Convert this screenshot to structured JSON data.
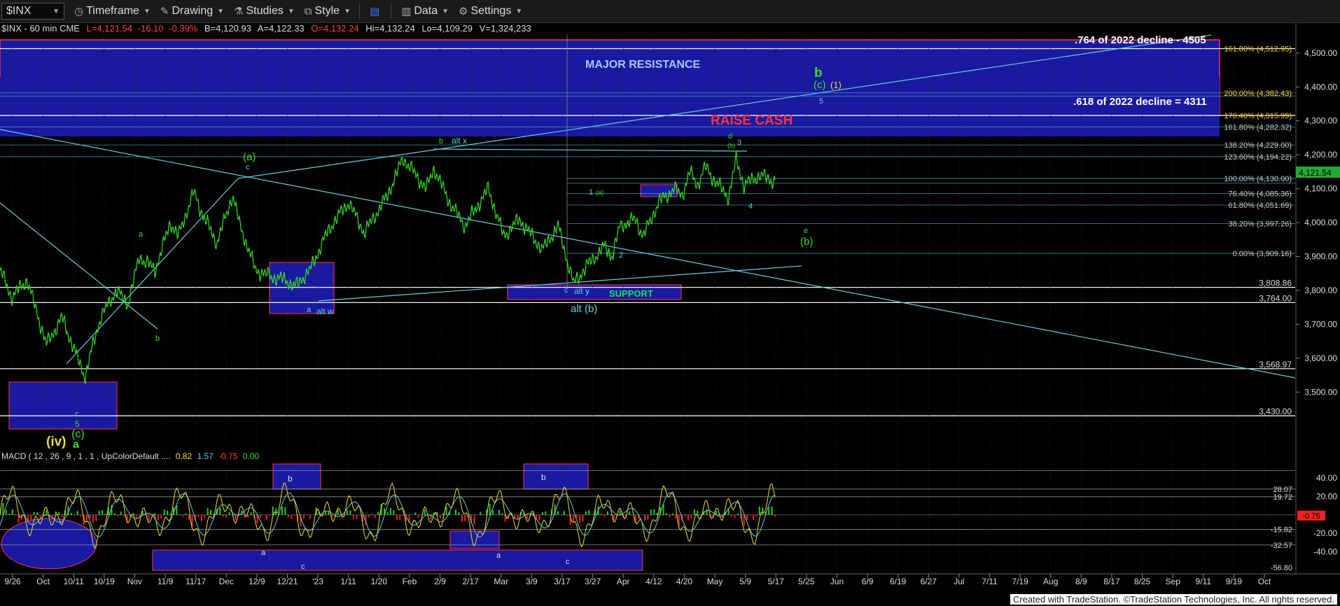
{
  "toolbar": {
    "symbol": "$INX",
    "items": [
      "Timeframe",
      "Drawing",
      "Studies",
      "Style",
      "Data",
      "Settings"
    ]
  },
  "quote_line": {
    "name": "$INX - 60 min  CME",
    "L": "L=4,121.54",
    "chg": "-16.10",
    "pct": "-0.39%",
    "B": "B=4,120.93",
    "A": "A=4,122.33",
    "O": "O=4,132.24",
    "Hi": "Hi=4,132.24",
    "Lo": "Lo=4,109.29",
    "V": "V=1,324,233"
  },
  "macd_label": {
    "name": "MACD ( 12 , 26 , 9 , 1 , 1 , UpColorDefault ....",
    "v1": "0.82",
    "v2": "1.57",
    "v3": "-0.75",
    "v4": "0.00"
  },
  "footer": "Created with TradeStation. ©TradeStation Technologies, Inc. All rights reserved.",
  "colors": {
    "background": "#000000",
    "price": "#33dd22",
    "box_fill": "#1a1aa0",
    "box_edge": "#ff3355",
    "cyan": "#66ccdd",
    "up_hist": "#22cc22",
    "down_hist": "#ee2222",
    "last_price_badge": "#22aa33"
  },
  "chart_data": {
    "type": "line",
    "title": "",
    "price_axis": {
      "ylim": [
        3385,
        4545
      ],
      "ticks": [
        3500,
        3600,
        3700,
        3800,
        3900,
        4000,
        4100,
        4200,
        4300,
        4400,
        4500
      ],
      "tick_labels": [
        "3,500.00",
        "3,600.00",
        "3,700.00",
        "3,800.00",
        "3,900.00",
        "4,000.00",
        "4,100.00",
        "4,200.00",
        "4,300.00",
        "4,400.00",
        "4,500.00"
      ]
    },
    "macd_axis": {
      "ylim": [
        -60,
        56
      ],
      "ticks": [
        40,
        20,
        -20,
        -40
      ],
      "tick_labels": [
        "40.00",
        "20.00",
        "-20.00",
        "-40.00"
      ]
    },
    "x_axis_labels": [
      "9/26",
      "Oct",
      "10/11",
      "10/19",
      "Nov",
      "11/9",
      "11/17",
      "Dec",
      "12/9",
      "12/21",
      "'23",
      "1/11",
      "1/20",
      "Feb",
      "2/9",
      "2/17",
      "Mar",
      "3/9",
      "3/17",
      "3/27",
      "Apr",
      "4/12",
      "4/20",
      "May",
      "5/9",
      "5/17",
      "5/25",
      "Jun",
      "6/9",
      "6/19",
      "6/27",
      "Jul",
      "7/11",
      "7/19",
      "Aug",
      "8/9",
      "8/17",
      "8/25",
      "Sep",
      "9/11",
      "9/19",
      "Oct"
    ],
    "price_path": {
      "t": [
        0,
        0.015,
        0.035,
        0.06,
        0.08,
        0.1,
        0.11,
        0.12,
        0.13,
        0.15,
        0.165,
        0.18,
        0.2,
        0.22,
        0.23,
        0.25,
        0.26,
        0.28,
        0.3,
        0.31,
        0.33,
        0.35,
        0.37,
        0.38,
        0.4,
        0.42,
        0.43,
        0.45,
        0.47,
        0.5,
        0.52,
        0.55,
        0.56,
        0.58,
        0.6,
        0.63,
        0.65,
        0.67,
        0.7,
        0.72,
        0.74,
        0.76,
        0.78,
        0.79,
        0.8,
        0.82,
        0.83,
        0.85,
        0.87,
        0.88,
        0.89,
        0.9,
        0.91,
        0.92,
        0.94,
        0.95,
        0.96,
        0.98,
        1.0
      ],
      "v": [
        3860,
        3780,
        3830,
        3640,
        3720,
        3600,
        3545,
        3640,
        3720,
        3800,
        3760,
        3900,
        3860,
        4000,
        3960,
        4090,
        4030,
        3940,
        4080,
        3990,
        3860,
        3840,
        3830,
        3810,
        3860,
        3960,
        4000,
        4060,
        3970,
        4080,
        4190,
        4100,
        4160,
        4060,
        3990,
        4100,
        3960,
        4010,
        3920,
        3990,
        3820,
        3880,
        3930,
        3900,
        3990,
        4010,
        3960,
        4060,
        4100,
        4080,
        4150,
        4110,
        4165,
        4130,
        4075,
        4185,
        4110,
        4140,
        4121
      ]
    },
    "resistance_levels": [
      "4,512.95",
      "4,382.43",
      "4,373.20",
      "4,315.99",
      "4,282.32",
      "4,229.00",
      "4,194.22",
      "4,130.00",
      "4,115.94",
      "4,085.36",
      "4,051.69",
      "3,997.26",
      "3,909.16",
      "3,808.86",
      "3,764.00",
      "3,568.97",
      "3,430.00"
    ],
    "fib_labels": [
      "161.80% (4,512.95)",
      "200.00% (4,382.43)",
      "176.40% (4,315.99)",
      "161.80% (4,282.32)",
      "138.20% (4,229.00)",
      "123.60% (4,194.22)",
      "100.00% (4,130.00)",
      "76.40% (4,085.36)",
      "61.80% (4,051.69)",
      "38.20% (3,997.26)",
      "0.00% (3,909.16)"
    ],
    "last_price": "4,121.54",
    "macd_right_labels": [
      "28.07",
      "19.72",
      "-0.75",
      "-15.82",
      "-32.57",
      "-56.80"
    ],
    "annotations": {
      "major_resistance": "MAJOR RESISTANCE",
      "raise_cash": "RAISE CASH",
      "support": "SUPPORT",
      "fib_764": ".764 of 2022 decline - 4505",
      "fib_618": ".618 of 2022 decline = 4311",
      "alt_b": "alt (b)",
      "alt_w": "alt w",
      "alt_x": "alt x",
      "alt_y": "alt y",
      "wave_iv": "(iv)",
      "wave_c_bottom": "(c)",
      "wave_a_bottom": "a",
      "wave_5_bottom": "5",
      "wave_c_small": "c",
      "wave_a_green": "a",
      "wave_b_green": "b",
      "wave_a_paren": "(a)",
      "wave_c_top": "c",
      "wave_b_feb": "b",
      "wave_a_dec": "a",
      "wave_c_mar": "c",
      "wave_1": "1",
      "wave_1a": "(a)",
      "wave_2": "2",
      "wave_2b": "(b)",
      "wave_3": "3",
      "wave_3b": "(b)",
      "wave_d": "d",
      "wave_4": "4",
      "wave_e": "e",
      "wave_b_paren": "(b)",
      "wave_big_b": "b",
      "wave_c_paren": "(c)",
      "wave_1_paren": "(1)",
      "wave_5_top": "5",
      "macd_b1": "b",
      "macd_b2": "b",
      "macd_a1": "a",
      "macd_c1": "c",
      "macd_a2": "a",
      "macd_c2": "c"
    }
  }
}
